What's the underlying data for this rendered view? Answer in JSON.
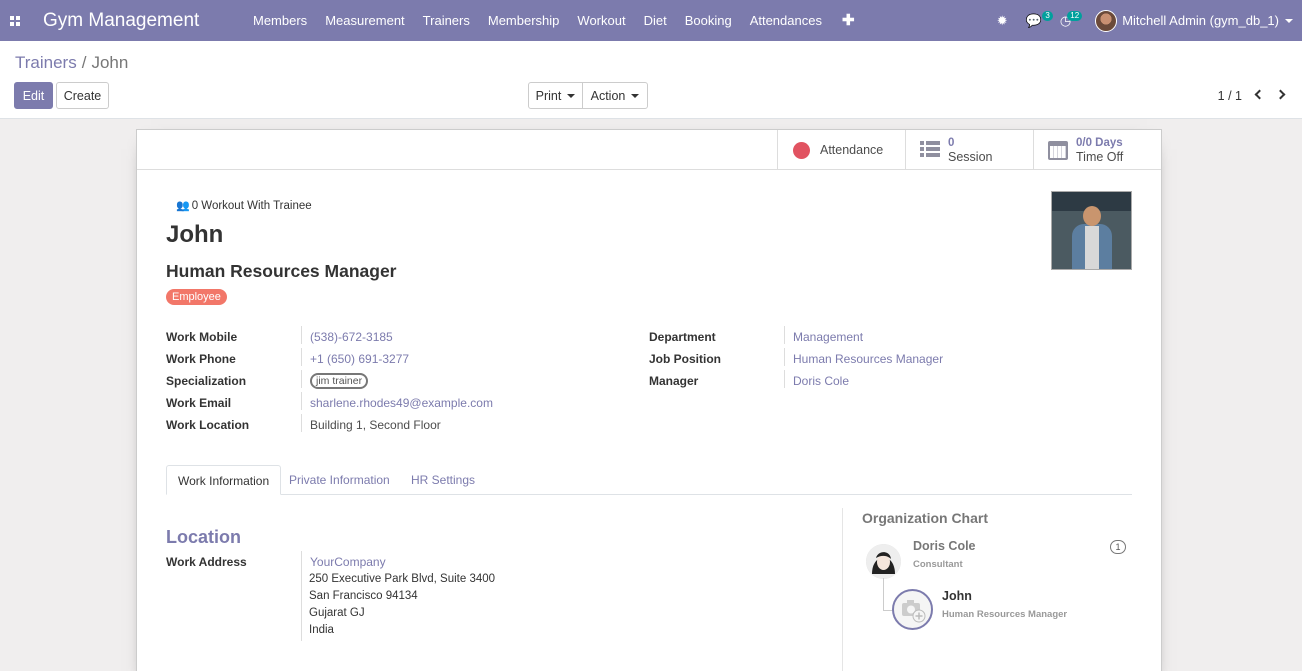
{
  "app": {
    "title": "Gym Management",
    "menu": [
      "Members",
      "Measurement",
      "Trainers",
      "Membership",
      "Workout",
      "Diet",
      "Booking",
      "Attendances"
    ],
    "messages_count": "3",
    "activities_count": "12",
    "user": "Mitchell Admin (gym_db_1)",
    "accent_color": "#7c7bad"
  },
  "breadcrumb": {
    "parent": "Trainers",
    "separator": "/",
    "current": "John"
  },
  "toolbar": {
    "edit": "Edit",
    "create": "Create",
    "print": "Print",
    "action": "Action"
  },
  "pager": {
    "value": "1 / 1"
  },
  "stat_buttons": {
    "attendance": "Attendance",
    "session_value": "0",
    "session_label": "Session",
    "timeoff_value": "0/0 Days",
    "timeoff_label": "Time Off"
  },
  "employee": {
    "workout_link": "0 Workout With Trainee",
    "name": "John",
    "job_title": "Human Resources Manager",
    "tag": "Employee"
  },
  "fields_left": [
    {
      "label": "Work Mobile",
      "value": "(538)-672-3185"
    },
    {
      "label": "Work Phone",
      "value": "+1 (650) 691-3277"
    },
    {
      "label": "Specialization",
      "value": "jim trainer"
    },
    {
      "label": "Work Email",
      "value": "sharlene.rhodes49@example.com"
    },
    {
      "label": "Work Location",
      "value": "Building 1, Second Floor"
    }
  ],
  "fields_right": [
    {
      "label": "Department",
      "value": "Management"
    },
    {
      "label": "Job Position",
      "value": "Human Resources Manager"
    },
    {
      "label": "Manager",
      "value": "Doris Cole"
    }
  ],
  "tabs": [
    "Work Information",
    "Private Information",
    "HR Settings"
  ],
  "location": {
    "title": "Location",
    "label": "Work Address",
    "company": "YourCompany",
    "lines": [
      "250 Executive Park Blvd, Suite 3400",
      "San Francisco 94134",
      "Gujarat GJ",
      "India"
    ]
  },
  "org_chart": {
    "title": "Organization Chart",
    "manager_name": "Doris Cole",
    "manager_job": "Consultant",
    "manager_count": "1",
    "self_name": "John",
    "self_job": "Human Resources Manager"
  }
}
